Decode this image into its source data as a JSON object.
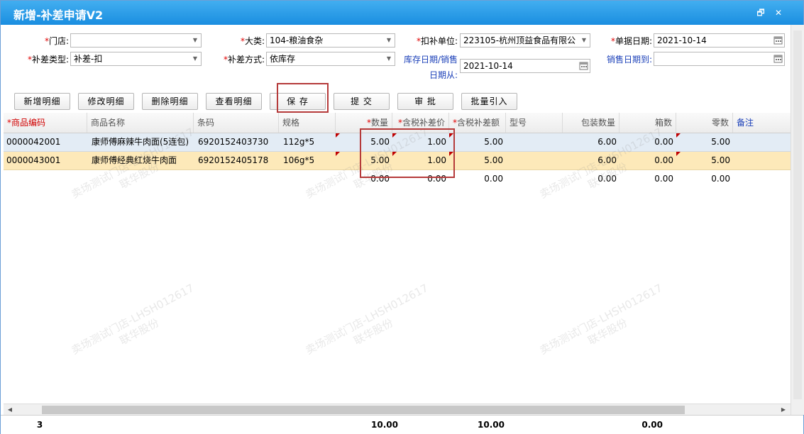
{
  "window": {
    "title": "新增-补差申请V2",
    "restore_label": "🗗",
    "close_label": "✕"
  },
  "form": {
    "store": {
      "label": "门店:",
      "value": ""
    },
    "category": {
      "label": "大类:",
      "value": "104-粮油食杂"
    },
    "deduct_unit": {
      "label": "扣补单位:",
      "value": "223105-杭州顶益食品有限公"
    },
    "doc_date": {
      "label": "单据日期:",
      "value": "2021-10-14"
    },
    "diff_type": {
      "label": "补差类型:",
      "value": "补差-扣"
    },
    "diff_method": {
      "label": "补差方式:",
      "value": "依库存"
    },
    "stock_date_line1": "库存日期/销售",
    "stock_date_line2": "日期从:",
    "stock_date": {
      "value": "2021-10-14"
    },
    "sales_date_to": {
      "label": "销售日期到:",
      "value": ""
    }
  },
  "toolbar": {
    "add_detail": "新增明细",
    "edit_detail": "修改明细",
    "delete_detail": "删除明细",
    "view_detail": "查看明细",
    "save": "保 存",
    "submit": "提 交",
    "approve": "审 批",
    "batch_import": "批量引入"
  },
  "grid": {
    "headers": {
      "code": "商品编码",
      "name": "商品名称",
      "barcode": "条码",
      "spec": "规格",
      "qty": "数量",
      "price": "含税补差价",
      "amount": "含税补差额",
      "model": "型号",
      "pack_qty": "包装数量",
      "boxes": "箱数",
      "units": "零数",
      "remark": "备注"
    },
    "rows": [
      {
        "code": "0000042001",
        "name": "康师傅麻辣牛肉面(5连包)",
        "barcode": "6920152403730",
        "spec": "112g*5",
        "qty": "5.00",
        "price": "1.00",
        "amount": "5.00",
        "model": "",
        "pack_qty": "6.00",
        "boxes": "0.00",
        "units": "5.00",
        "remark": ""
      },
      {
        "code": "0000043001",
        "name": "康师傅经典红烧牛肉面",
        "barcode": "6920152405178",
        "spec": "106g*5",
        "qty": "5.00",
        "price": "1.00",
        "amount": "5.00",
        "model": "",
        "pack_qty": "6.00",
        "boxes": "0.00",
        "units": "5.00",
        "remark": ""
      },
      {
        "code": "",
        "name": "",
        "barcode": "",
        "spec": "",
        "qty": "0.00",
        "price": "0.00",
        "amount": "0.00",
        "model": "",
        "pack_qty": "0.00",
        "boxes": "0.00",
        "units": "0.00",
        "remark": ""
      }
    ]
  },
  "footer": {
    "row_count": "3",
    "qty_total": "10.00",
    "amount_total": "10.00",
    "boxes_total": "0.00"
  },
  "watermark": {
    "line1": "卖场测试门店-LHSH012617",
    "line2": "联华股份"
  },
  "colors": {
    "title_bar": "#1a8ee0",
    "required_star": "#e00000",
    "selected_row": "#fde9b9",
    "highlight_border": "#b53a3a"
  }
}
